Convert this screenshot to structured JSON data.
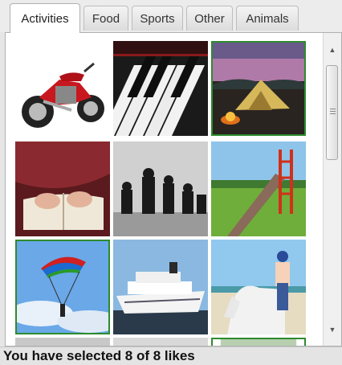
{
  "tabs": [
    {
      "label": "Activities",
      "active": true
    },
    {
      "label": "Food",
      "active": false
    },
    {
      "label": "Sports",
      "active": false
    },
    {
      "label": "Other",
      "active": false
    },
    {
      "label": "Animals",
      "active": false
    }
  ],
  "images": [
    {
      "subject": "motorcycle",
      "selected": false
    },
    {
      "subject": "piano-keys",
      "selected": false
    },
    {
      "subject": "camping-tent",
      "selected": true
    },
    {
      "subject": "reading-book",
      "selected": false
    },
    {
      "subject": "chess-pieces",
      "selected": false
    },
    {
      "subject": "playground-slide",
      "selected": false
    },
    {
      "subject": "parachuting",
      "selected": true
    },
    {
      "subject": "cruise-ship",
      "selected": false
    },
    {
      "subject": "horse-riding",
      "selected": false
    }
  ],
  "scrollbar": {
    "up_icon": "arrow-up-icon",
    "down_icon": "arrow-down-icon",
    "grip_icon": "grip-icon"
  },
  "status": {
    "text": "You have selected 8 of 8 likes"
  },
  "colors": {
    "selected_border": "#2e8b2e",
    "panel_bg": "#ffffff"
  }
}
